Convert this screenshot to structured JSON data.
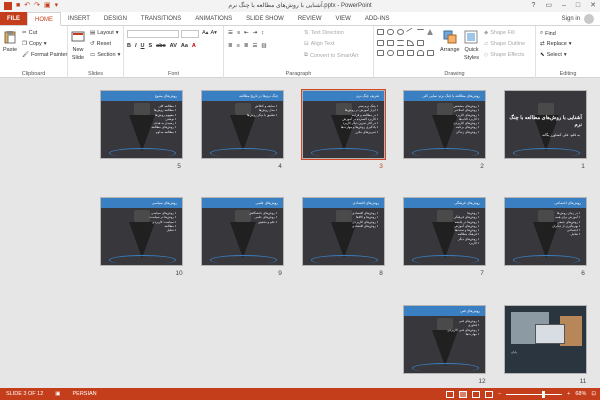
{
  "window": {
    "title": "آشنایی با روش‌های مطالعه با چنگ نرم.pptx - PowerPoint",
    "controls": [
      "?",
      "▭",
      "–",
      "□",
      "✕"
    ]
  },
  "tabs": [
    {
      "label": "FILE"
    },
    {
      "label": "HOME"
    },
    {
      "label": "INSERT"
    },
    {
      "label": "DESIGN"
    },
    {
      "label": "TRANSITIONS"
    },
    {
      "label": "ANIMATIONS"
    },
    {
      "label": "SLIDE SHOW"
    },
    {
      "label": "REVIEW"
    },
    {
      "label": "VIEW"
    },
    {
      "label": "ADD-INS"
    }
  ],
  "signin": "Sign in",
  "ribbon": {
    "clipboard": {
      "label": "Clipboard",
      "paste": "Paste",
      "cut": "Cut",
      "copy": "Copy",
      "format_painter": "Format Painter"
    },
    "slides": {
      "label": "Slides",
      "new_slide": "New",
      "new_slide2": "Slide",
      "layout": "Layout",
      "reset": "Reset",
      "section": "Section"
    },
    "font": {
      "label": "Font"
    },
    "paragraph": {
      "label": "Paragraph",
      "text_direction": "Text Direction",
      "align_text": "Align Text",
      "convert_smartart": "Convert to SmartArt"
    },
    "drawing": {
      "label": "Drawing",
      "arrange": "Arrange",
      "quick_styles": "Quick",
      "quick_styles2": "Styles",
      "shape_fill": "Shape Fill",
      "shape_outline": "Shape Outline",
      "shape_effects": "Shape Effects"
    },
    "editing": {
      "label": "Editing",
      "find": "Find",
      "replace": "Replace",
      "select": "Select"
    }
  },
  "slides": [
    {
      "num": "1",
      "header": "",
      "title": "آشنایی با روش‌های مطالعه با چنگ نرم",
      "sub": "به قلم: علی کشاورز یگانه",
      "bullets": []
    },
    {
      "num": "2",
      "header": "روش‌های مطالعه با چنگ نرم: نمایی کلی",
      "title": "",
      "sub": "",
      "bullets": [
        "روش‌های مشخص",
        "روش‌های اصلاحی",
        "روش‌های کاربرد",
        "کاربرد کتاب‌ها",
        "روش‌های کاربردی",
        "روش‌های برنامه",
        "روش‌های زندگی"
      ]
    },
    {
      "num": "3",
      "header": "تعریف چنگ نرم",
      "title": "",
      "sub": "",
      "bullets": [
        "چنگ نرم یعنی",
        "ابزار آموزش در روش‌ها",
        "در مطالعه و فرایند",
        "کاربرد گسترده در آموزش",
        "در کنار تمرین دیگر کاربرد",
        "یادگیری روش‌ها و مهارت‌ها",
        "تمرین‌های مکرر"
      ]
    },
    {
      "num": "4",
      "header": "چنگ نرم‌ها در تاریخ مطالعه",
      "title": "",
      "sub": "",
      "bullets": [
        "سابقه و کنکاش",
        "مدل روش‌ها",
        "تطبیق با دیگر روش‌ها"
      ]
    },
    {
      "num": "5",
      "header": "روش‌های متنوع",
      "title": "",
      "sub": "",
      "bullets": [
        "مطالعه کلی",
        "مطالعه روش‌ها",
        "مفهوم روش‌ها",
        "نوشتن",
        "رسیدن به هدف",
        "روش‌های مطالعه",
        "مطالعه مداوم"
      ]
    },
    {
      "num": "6",
      "header": "روش‌های اجتماعی",
      "title": "",
      "sub": "",
      "bullets": [
        "در زمان روش‌ها",
        "آموزش برای همه",
        "روش‌های جمعی",
        "بهره‌گیری از دیگران",
        "اجتماعی",
        "تعامل"
      ]
    },
    {
      "num": "7",
      "header": "روش‌های فرهنگی",
      "title": "",
      "sub": "",
      "bullets": [
        "روش‌ها",
        "روش‌های فرهنگی",
        "روش‌ها در جامعه",
        "روش‌های آموزش",
        "روش‌ها و سنت‌ها",
        "فرهنگ مطالعه",
        "روش‌های دیگر",
        "کاربرد"
      ]
    },
    {
      "num": "8",
      "header": "روش‌های اقتصادی",
      "title": "",
      "sub": "",
      "bullets": [
        "روش‌های اقتصادی",
        "روش‌ها و کالاها",
        "روش‌های کاربردی",
        "روش‌های اقتصادی"
      ]
    },
    {
      "num": "9",
      "header": "روش‌های علمی",
      "title": "",
      "sub": "",
      "bullets": [
        "روش‌های دانشگاهی",
        "روش‌های علمی",
        "علم و تحقیق"
      ]
    },
    {
      "num": "10",
      "header": "روش‌های سیاسی",
      "title": "",
      "sub": "",
      "bullets": [
        "روش‌های سیاسی",
        "روش‌ها در سیاست",
        "سیاست کاربردی",
        "مطالعه",
        "تحلیل"
      ]
    },
    {
      "num": "11",
      "header": "",
      "title": "",
      "sub": "",
      "caption": "پایان",
      "bullets": []
    },
    {
      "num": "12",
      "header": "روش‌های فنی",
      "title": "",
      "sub": "",
      "bullets": [
        "روش‌های فنی",
        "فناوری",
        "روش‌های فنی کاربردی",
        "مهارت‌ها"
      ]
    }
  ],
  "status": {
    "slide_info": "SLIDE 3 OF 12",
    "language": "PERSIAN",
    "zoom": "68%",
    "zoom_fraction": 0.68
  },
  "colors": {
    "accent": "#c43e1c",
    "slide_header": "#3a7fc1"
  }
}
